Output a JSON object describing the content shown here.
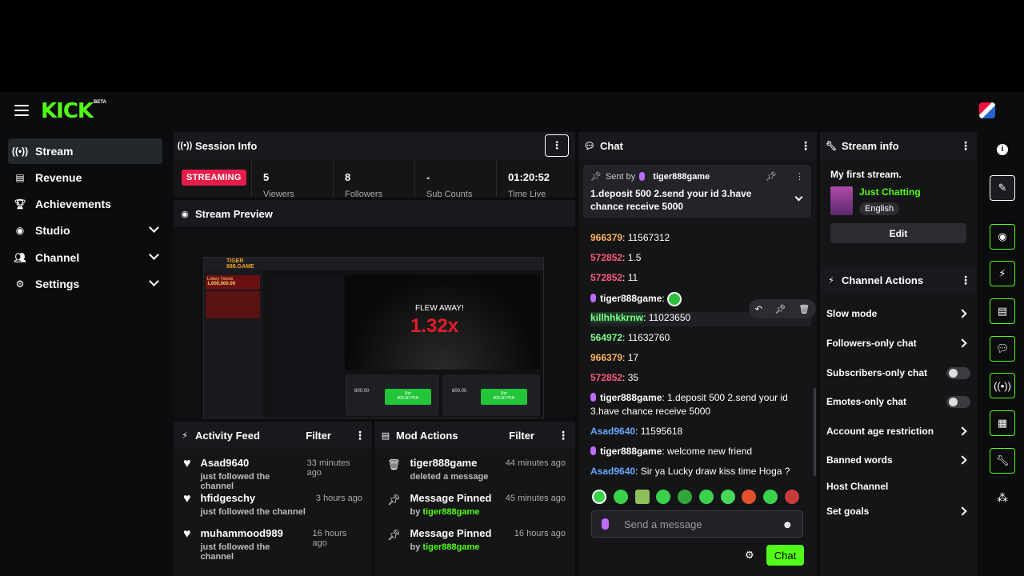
{
  "brand": {
    "logo": "KICK",
    "beta": "BETA"
  },
  "sidebar": {
    "items": [
      {
        "label": "Stream",
        "icon": "broadcast-icon"
      },
      {
        "label": "Revenue",
        "icon": "chart-icon"
      },
      {
        "label": "Achievements",
        "icon": "trophy-icon"
      },
      {
        "label": "Studio",
        "icon": "camera-icon"
      },
      {
        "label": "Channel",
        "icon": "users-icon"
      },
      {
        "label": "Settings",
        "icon": "gear-icon"
      }
    ]
  },
  "session": {
    "title": "Session Info",
    "status": "STREAMING",
    "stats": [
      {
        "value": "5",
        "label": "Viewers"
      },
      {
        "value": "8",
        "label": "Followers"
      },
      {
        "value": "-",
        "label": "Sub Counts"
      },
      {
        "value": "01:20:52",
        "label": "Time Live"
      }
    ]
  },
  "preview": {
    "title": "Stream Preview",
    "game_brand": "TIGER 888.GAME",
    "lottery": "Lottery Tickets",
    "lottery_amount": "1,000,000.00",
    "flew_away": "FLEW AWAY!",
    "multiplier": "1.32x",
    "bet_label": "Bet",
    "bet_amount": "800.00",
    "bet_btn_amount": "800.00 PKR"
  },
  "activity": {
    "title": "Activity Feed",
    "filter": "Filter",
    "items": [
      {
        "name": "Asad9640",
        "action": "just followed the channel",
        "time": "33 minutes ago"
      },
      {
        "name": "hfidgeschy",
        "action": "just followed the channel",
        "time": "3 hours ago"
      },
      {
        "name": "muhammood989",
        "action": "just followed the channel",
        "time": "16 hours ago"
      }
    ]
  },
  "mod": {
    "title": "Mod Actions",
    "filter": "Filter",
    "items": [
      {
        "title": "tiger888game",
        "sub_prefix": "",
        "sub_user": "",
        "sub_text": "deleted a message",
        "time": "44 minutes ago",
        "icon": "trash-icon"
      },
      {
        "title": "Message Pinned",
        "sub_prefix": "by ",
        "sub_user": "tiger888game",
        "sub_text": "",
        "time": "45 minutes ago",
        "icon": "pin-icon"
      },
      {
        "title": "Message Pinned",
        "sub_prefix": "by ",
        "sub_user": "tiger888game",
        "sub_text": "",
        "time": "16 hours ago",
        "icon": "pin-icon"
      }
    ]
  },
  "chat": {
    "title": "Chat",
    "pinned": {
      "sent_by": "Sent by",
      "user": "tiger888game",
      "message": "1.deposit 500 2.send your id 3.have chance receive 5000"
    },
    "messages": [
      {
        "user": "966379",
        "text": ": 11567312",
        "color": "orange"
      },
      {
        "user": "572852",
        "text": ": 1.5",
        "color": "red"
      },
      {
        "user": "572852",
        "text": ": 11",
        "color": "red"
      },
      {
        "user": "tiger888game",
        "text": ":",
        "color": "purple"
      },
      {
        "user": "killhhkkrnw",
        "text": ": 11023650",
        "color": "green"
      },
      {
        "user": "564972",
        "text": ": 11632760",
        "color": "green"
      },
      {
        "user": "966379",
        "text": ": 17",
        "color": "orange"
      },
      {
        "user": "572852",
        "text": ": 35",
        "color": "red"
      },
      {
        "user": "tiger888game",
        "text": ": 1.deposit 500 2.send your id",
        "color": "purple"
      },
      {
        "user": "",
        "text": "3.have chance receive 5000",
        "color": ""
      },
      {
        "user": "Asad9640",
        "text": ": 11595618",
        "color": "blue"
      },
      {
        "user": "tiger888game",
        "text": ": welcome new friend",
        "color": "purple"
      },
      {
        "user": "Asad9640",
        "text": ": Sir ya Lucky draw kiss time Hoga ?",
        "color": "blue"
      }
    ],
    "placeholder": "Send a message",
    "send": "Chat"
  },
  "stream_info": {
    "title": "Stream info",
    "stream_title": "My first stream.",
    "category": "Just Chatting",
    "language": "English",
    "edit": "Edit"
  },
  "channel_actions": {
    "title": "Channel Actions",
    "items": [
      {
        "label": "Slow mode",
        "control": "chevron"
      },
      {
        "label": "Followers-only chat",
        "control": "chevron"
      },
      {
        "label": "Subscribers-only chat",
        "control": "toggle"
      },
      {
        "label": "Emotes-only chat",
        "control": "toggle"
      },
      {
        "label": "Account age restriction",
        "control": "chevron"
      },
      {
        "label": "Banned words",
        "control": "chevron"
      },
      {
        "label": "Host Channel",
        "control": "none"
      },
      {
        "label": "Set goals",
        "control": "chevron"
      }
    ]
  },
  "colors": {
    "accent": "#53fc18",
    "live": "#e51d48",
    "panel": "#141517"
  }
}
